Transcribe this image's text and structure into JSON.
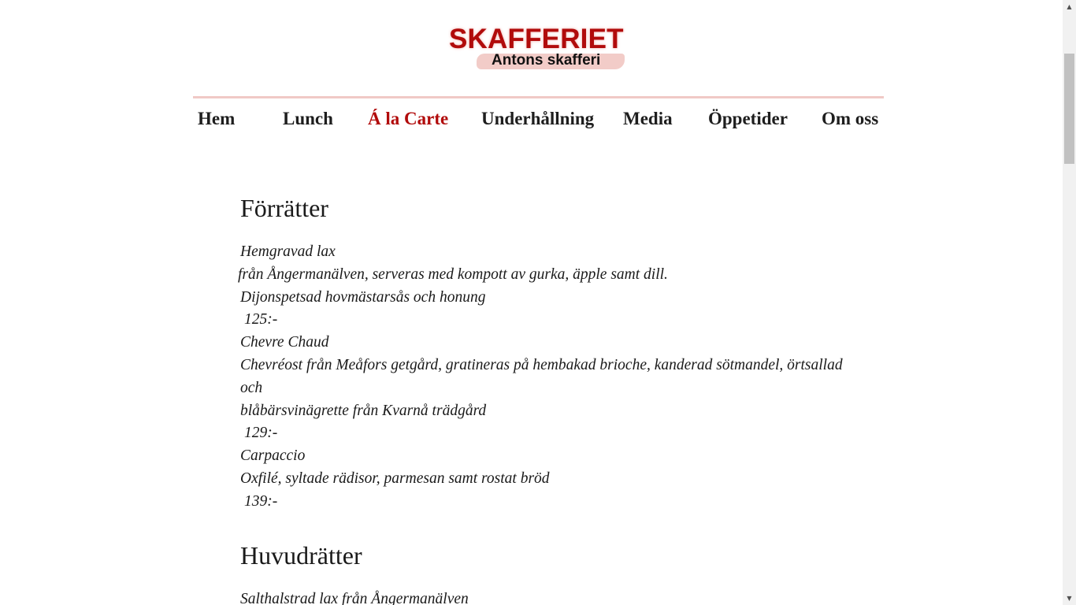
{
  "logo": {
    "title": "SKAFFERIET",
    "subtitle": "Antons skafferi"
  },
  "nav": {
    "items": [
      {
        "label": "Hem",
        "active": false
      },
      {
        "label": "Lunch",
        "active": false
      },
      {
        "label": "Á la Carte",
        "active": true
      },
      {
        "label": "Underhållning",
        "active": false
      },
      {
        "label": "Media",
        "active": false
      },
      {
        "label": "Öppetider",
        "active": false
      },
      {
        "label": "Om oss",
        "active": false
      }
    ]
  },
  "colors": {
    "accent": "#b10b0b",
    "divider": "#f0c9c6"
  },
  "forratter": {
    "title": "Förrätter",
    "lines": [
      "Hemgravad lax",
      "från Ångermanälven, serveras med kompott av gurka, äpple samt dill.",
      "Dijonspetsad hovmästarsås och honung",
      "125:-",
      "Chevre Chaud",
      "Chevréost från Meåfors getgård, gratineras på hembakad brioche, kanderad sötmandel, örtsallad och",
      "blåbärsvinägrette från Kvarnå trädgård",
      "129:-",
      "Carpaccio",
      "Oxfilé, syltade rädisor, parmesan samt rostat bröd",
      "139:-"
    ]
  },
  "huvudratter": {
    "title": "Huvudrätter",
    "lines": [
      "Salthalstrad lax från Ångermanälven"
    ]
  },
  "scrollbar": {
    "up_icon": "triangle-up-icon",
    "down_icon": "triangle-down-icon"
  }
}
